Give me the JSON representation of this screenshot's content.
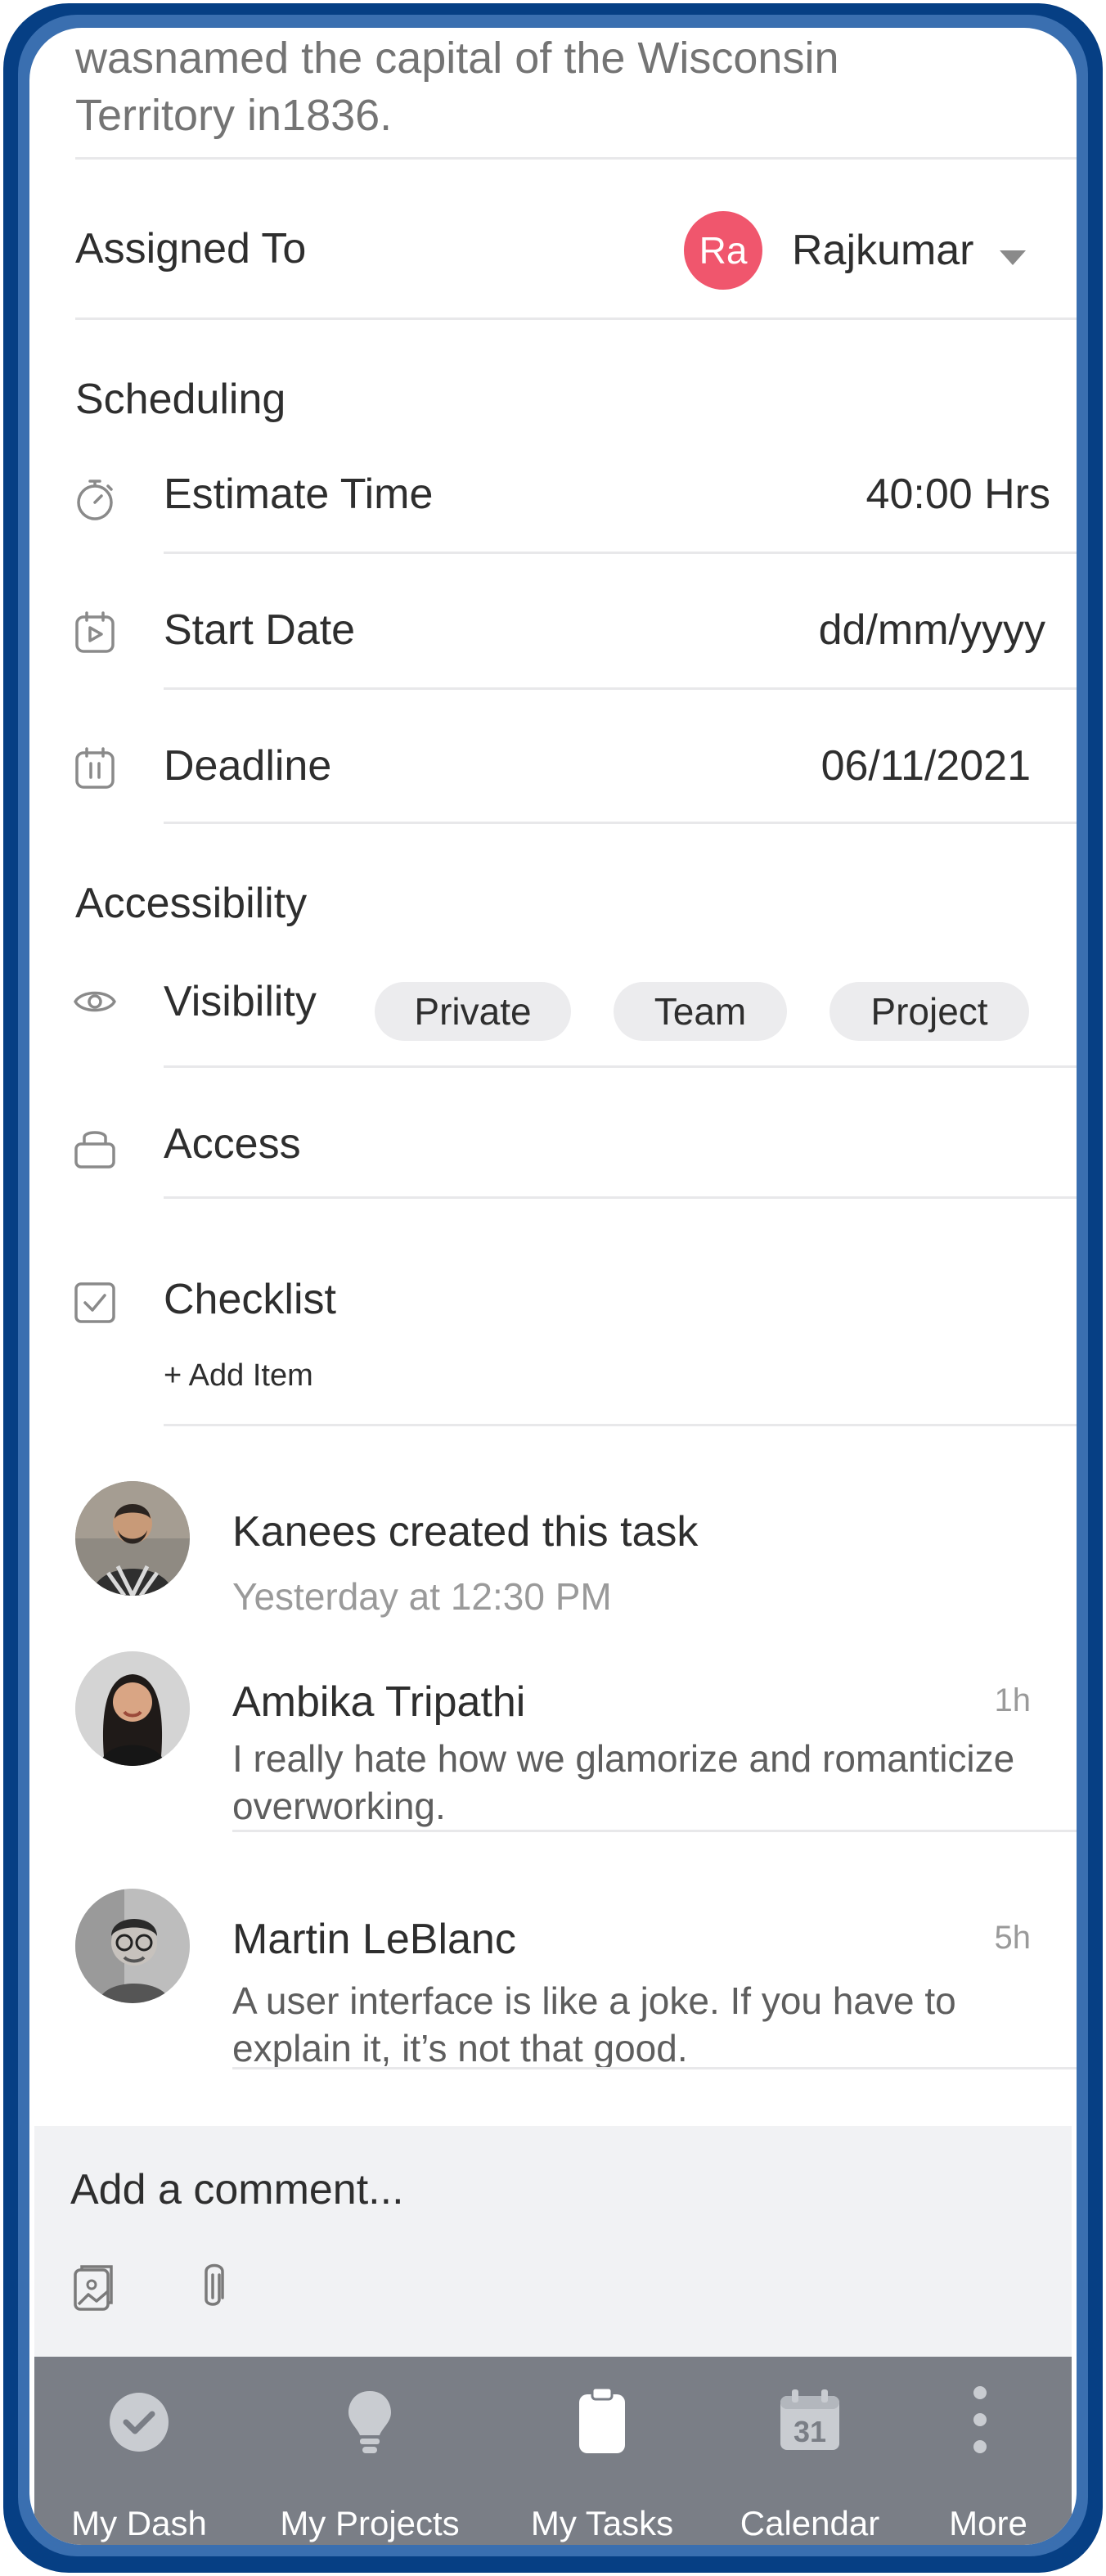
{
  "task": {
    "description_lines": [
      "wasnamed the capital of the Wisconsin",
      "Territory in1836."
    ]
  },
  "assigned": {
    "label": "Assigned To",
    "avatar_initials": "Ra",
    "avatar_color": "#f0566d",
    "name": "Rajkumar"
  },
  "scheduling": {
    "title": "Scheduling",
    "estimate": {
      "label": "Estimate Time",
      "value": "40:00 Hrs",
      "icon": "stopwatch-icon"
    },
    "start": {
      "label": "Start Date",
      "value": "dd/mm/yyyy",
      "icon": "calendar-play-icon"
    },
    "deadline": {
      "label": "Deadline",
      "value": "06/11/2021",
      "icon": "calendar-pause-icon"
    }
  },
  "accessibility": {
    "title": "Accessibility",
    "visibility": {
      "label": "Visibility",
      "icon": "eye-icon",
      "options": [
        "Private",
        "Team",
        "Project"
      ]
    },
    "access": {
      "label": "Access",
      "icon": "lock-icon"
    }
  },
  "checklist": {
    "label": "Checklist",
    "icon": "checkbox-icon",
    "add_item": "+ Add Item"
  },
  "activity": [
    {
      "title": "Kanees created this task",
      "subtitle": "Yesterday at 12:30 PM"
    },
    {
      "title": "Ambika Tripathi",
      "time": "1h",
      "body": "I really hate how we glamorize and romanticize overworking."
    },
    {
      "title": "Martin LeBlanc",
      "time": "5h",
      "body": "A user interface is like a joke. If you have to explain it, it’s not that good."
    }
  ],
  "comment": {
    "placeholder": "Add a comment...",
    "icons": [
      "image-attach-icon",
      "paperclip-icon"
    ]
  },
  "tabbar": {
    "items": [
      {
        "label": "My Dash",
        "icon": "check-circle-icon"
      },
      {
        "label": "My Projects",
        "icon": "lightbulb-icon"
      },
      {
        "label": "My Tasks",
        "icon": "clipboard-icon"
      },
      {
        "label": "Calendar",
        "icon": "calendar-icon",
        "icon_text": "31"
      },
      {
        "label": "More",
        "icon": "more-vertical-icon"
      }
    ]
  },
  "colors": {
    "frame": "#063f84",
    "accent_avatar": "#f0566d",
    "tabbar": "#7a7e86",
    "divider": "#e8e8ea"
  }
}
